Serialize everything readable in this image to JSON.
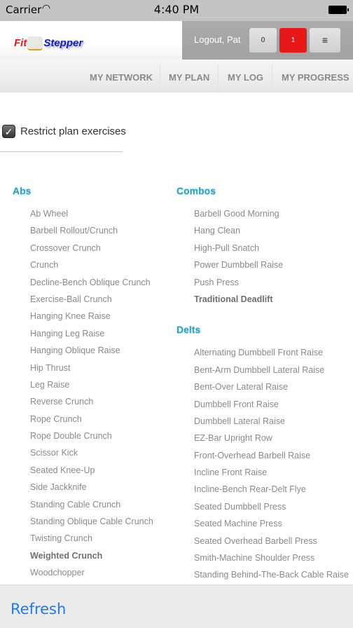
{
  "status_bar": {
    "carrier": "Carrier",
    "time": "4:40 PM",
    "wifi_icon": "wifi-icon",
    "battery_icon": "battery-icon"
  },
  "header": {
    "logo": {
      "fit": "Fit",
      "stepper": "Stepper"
    },
    "logout": "Logout, Pat",
    "btn_zero": "0",
    "btn_one": "1",
    "menu_icon": "≡",
    "accent_red": "#e81818"
  },
  "nav": [
    "MY NETWORK",
    "MY PLAN",
    "MY LOG",
    "MY PROGRESS"
  ],
  "restrict": {
    "label": "Restrict plan exercises",
    "checked": true
  },
  "left_sections": [
    {
      "title": "Abs",
      "items": [
        {
          "t": "Ab Wheel"
        },
        {
          "t": "Barbell Rollout/Crunch"
        },
        {
          "t": "Crossover Crunch"
        },
        {
          "t": "Crunch"
        },
        {
          "t": "Decline-Bench Oblique Crunch"
        },
        {
          "t": "Exercise-Ball Crunch"
        },
        {
          "t": "Hanging Knee Raise"
        },
        {
          "t": "Hanging Leg Raise"
        },
        {
          "t": "Hanging Oblique Raise"
        },
        {
          "t": "Hip Thrust"
        },
        {
          "t": "Leg Raise"
        },
        {
          "t": "Reverse Crunch"
        },
        {
          "t": "Rope Crunch"
        },
        {
          "t": "Rope Double Crunch"
        },
        {
          "t": "Scissor Kick"
        },
        {
          "t": "Seated Knee-Up"
        },
        {
          "t": "Side Jackknife"
        },
        {
          "t": "Standing Cable Crunch"
        },
        {
          "t": "Standing Oblique Cable Crunch"
        },
        {
          "t": "Twisting Crunch"
        },
        {
          "t": "Weighted Crunch",
          "bold": true
        },
        {
          "t": "Woodchopper"
        }
      ]
    }
  ],
  "right_sections": [
    {
      "title": "Combos",
      "items": [
        {
          "t": "Barbell Good Morning"
        },
        {
          "t": "Hang Clean"
        },
        {
          "t": "High-Pull Snatch"
        },
        {
          "t": "Power Dumbbell Raise"
        },
        {
          "t": "Push Press"
        },
        {
          "t": "Traditional Deadlift",
          "bold": true
        }
      ]
    },
    {
      "title": "Delts",
      "items": [
        {
          "t": "Alternating Dumbbell Front Raise"
        },
        {
          "t": "Bent-Arm Dumbbell Lateral Raise"
        },
        {
          "t": "Bent-Over Lateral Raise"
        },
        {
          "t": "Dumbbell Front Raise"
        },
        {
          "t": "Dumbbell Lateral Raise"
        },
        {
          "t": "EZ-Bar Upright Row"
        },
        {
          "t": "Front-Overhead Barbell Raise"
        },
        {
          "t": "Incline Front Raise"
        },
        {
          "t": "Incline-Bench Rear-Delt Flye"
        },
        {
          "t": "Seated Dumbbell Press"
        },
        {
          "t": "Seated Machine Press"
        },
        {
          "t": "Seated Overhead Barbell Press"
        },
        {
          "t": "Smith-Machine Shoulder Press"
        },
        {
          "t": "Standing Behind-The-Back Cable Raise"
        }
      ]
    }
  ],
  "toolbar": {
    "refresh": "Refresh"
  }
}
